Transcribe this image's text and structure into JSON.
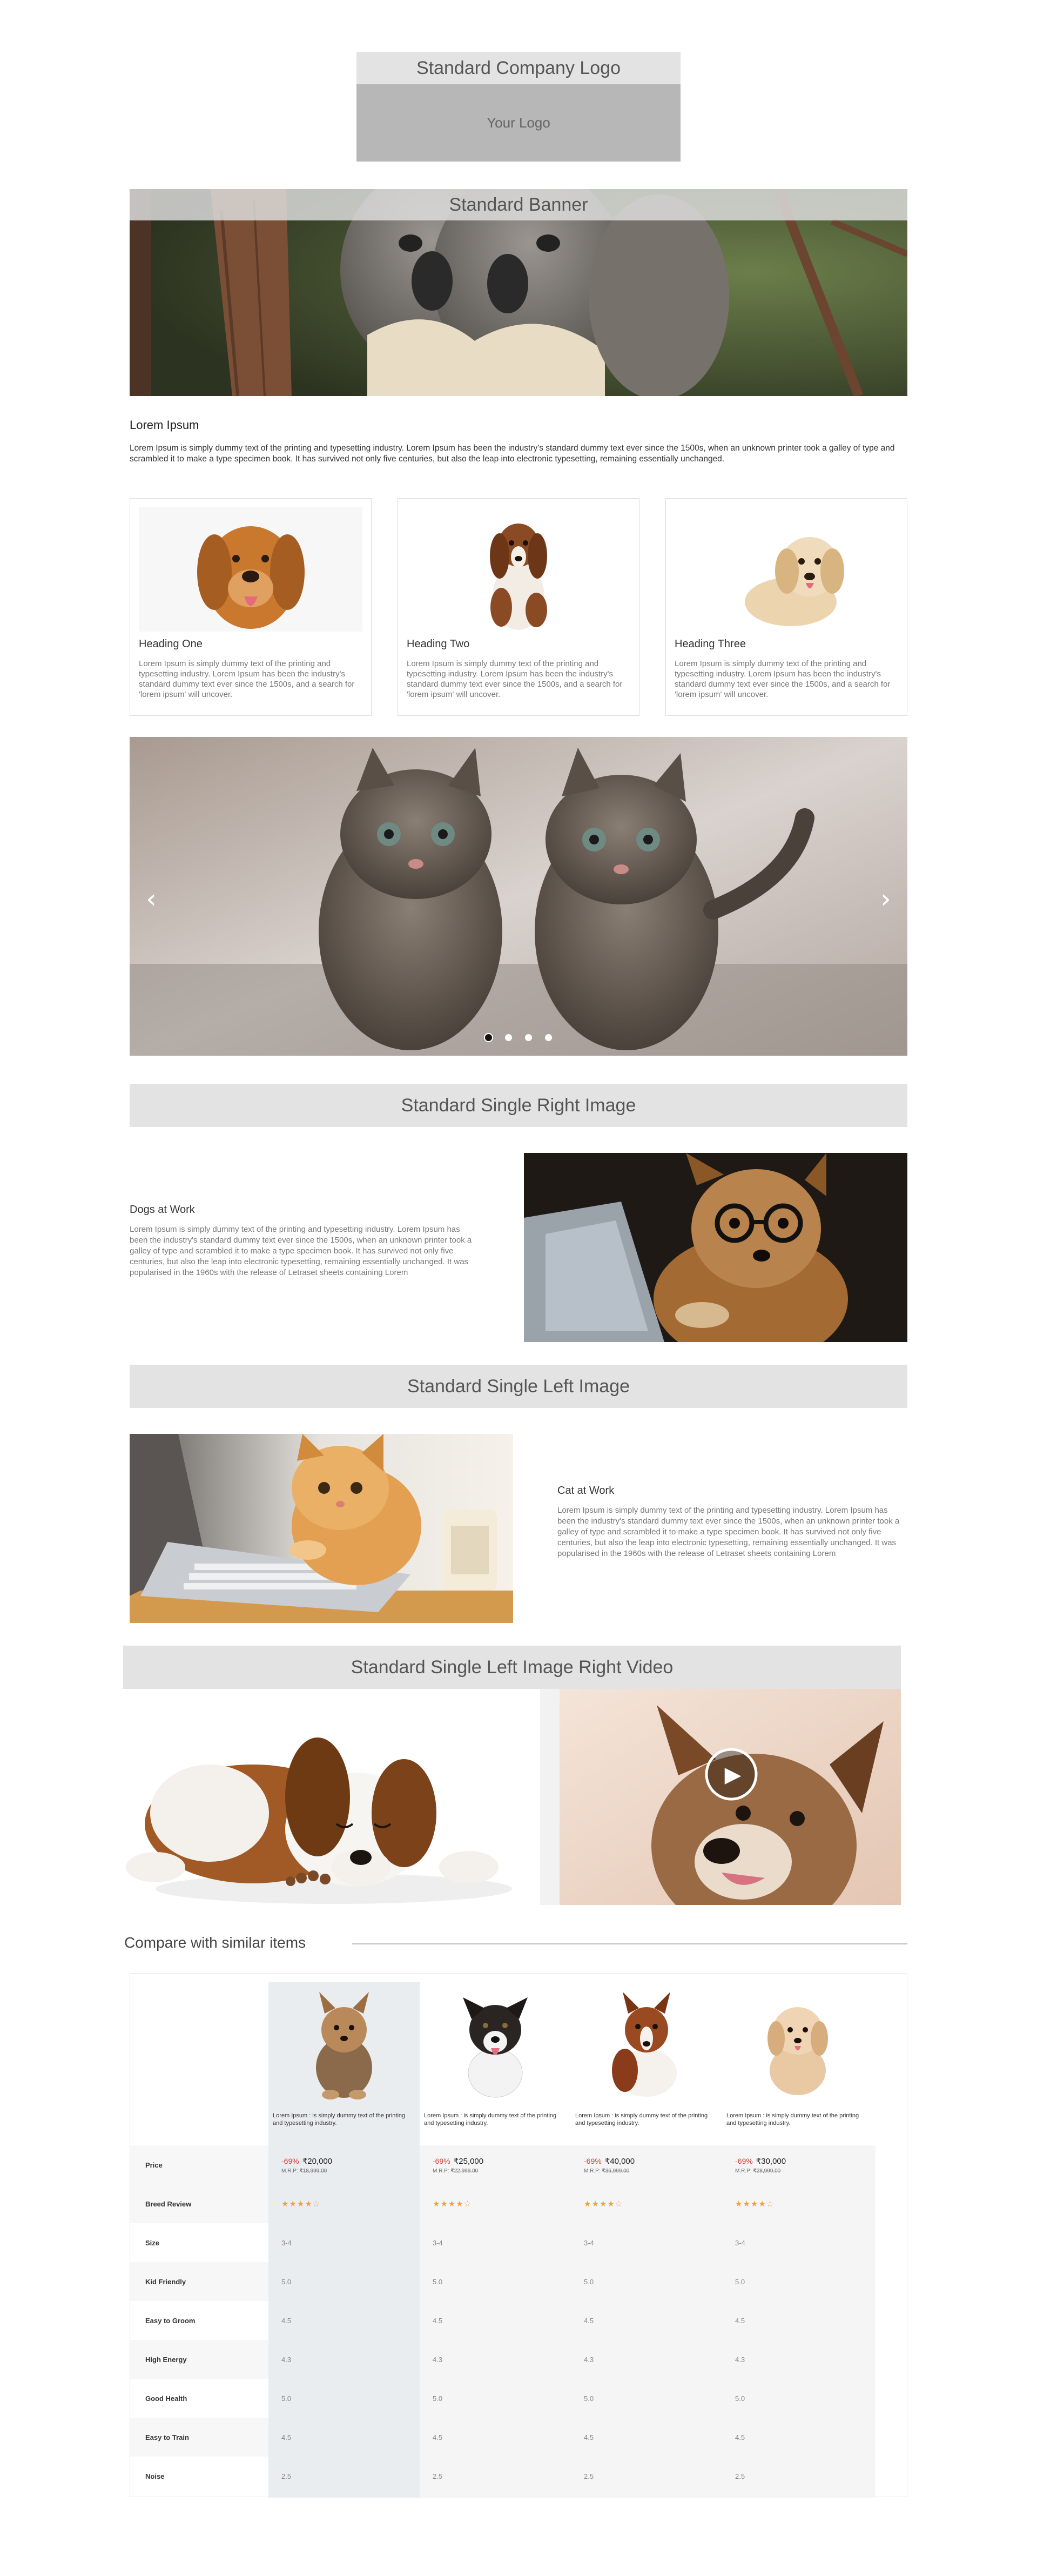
{
  "logo": {
    "title": "Standard Company Logo",
    "placeholder": "Your Logo"
  },
  "banner": {
    "title": "Standard Banner"
  },
  "intro": {
    "heading": "Lorem Ipsum",
    "text": "Lorem Ipsum is simply dummy text of the printing and typesetting industry. Lorem Ipsum has been the industry's standard dummy text ever since the 1500s, when an unknown printer took a galley of type and scrambled it to make a type specimen book. It has survived not only five centuries, but also the leap into electronic typesetting, remaining essentially unchanged."
  },
  "cards": [
    {
      "heading": "Heading One",
      "text": "Lorem Ipsum is simply dummy text of the printing and typesetting industry. Lorem Ipsum has been the industry's standard dummy text ever since the 1500s, and a search for 'lorem ipsum' will uncover."
    },
    {
      "heading": "Heading Two",
      "text": "Lorem Ipsum is simply dummy text of the printing and typesetting industry. Lorem Ipsum has been the industry's standard dummy text ever since the 1500s, and a search for 'lorem ipsum' will uncover."
    },
    {
      "heading": "Heading Three",
      "text": "Lorem Ipsum is simply dummy text of the printing and typesetting industry. Lorem Ipsum has been the industry's standard dummy text ever since the 1500s, and a search for 'lorem ipsum' will uncover."
    }
  ],
  "carousel": {
    "prev_icon": "chevron-left-icon",
    "next_icon": "chevron-right-icon",
    "prev": "‹",
    "next": "›",
    "slide_count": 4,
    "active_slide": 1
  },
  "right_image": {
    "bar": "Standard Single Right Image",
    "heading": "Dogs at Work",
    "text": "Lorem Ipsum is simply dummy text of the printing and typesetting industry. Lorem Ipsum has been the industry's standard dummy text ever since the 1500s, when an unknown printer took a galley of type and scrambled it to make a type specimen book. It has survived not only five centuries, but also the leap into electronic typesetting, remaining essentially unchanged. It was popularised in the 1960s with the release of Letraset sheets containing Lorem"
  },
  "left_image": {
    "bar": "Standard Single Left Image",
    "heading": "Cat at Work",
    "text": "Lorem Ipsum is simply dummy text of the printing and typesetting industry. Lorem Ipsum has been the industry's standard dummy text ever since the 1500s, when an unknown printer took a galley of type and scrambled it to make a type specimen book. It has survived not only five centuries, but also the leap into electronic typesetting, remaining essentially unchanged. It was popularised in the 1960s with the release of Letraset sheets containing Lorem"
  },
  "image_video": {
    "bar": "Standard Single Left Image Right Video",
    "play_icon": "play-icon"
  },
  "compare": {
    "title": "Compare with similar items",
    "products": [
      {
        "title": "Lorem Ipsum : is simply dummy text of the printing and typesetting industry.",
        "discount": "-69%",
        "price": "₹20,000",
        "mrp_label": "M.R.P:",
        "mrp": "₹18,999.00",
        "rating": "★★★★☆"
      },
      {
        "title": "Lorem Ipsum : is simply dummy text of the printing and typesetting industry.",
        "discount": "-69%",
        "price": "₹25,000",
        "mrp_label": "M.R.P:",
        "mrp": "₹22,999.00",
        "rating": "★★★★☆"
      },
      {
        "title": "Lorem Ipsum : is simply dummy text of the printing and typesetting industry.",
        "discount": "-69%",
        "price": "₹40,000",
        "mrp_label": "M.R.P:",
        "mrp": "₹36,999.00",
        "rating": "★★★★☆"
      },
      {
        "title": "Lorem Ipsum : is simply dummy text of the printing and typesetting industry.",
        "discount": "-69%",
        "price": "₹30,000",
        "mrp_label": "M.R.P:",
        "mrp": "₹28,999.00",
        "rating": "★★★★☆"
      }
    ],
    "row_labels": {
      "price": "Price",
      "review": "Breed Review",
      "size": "Size",
      "kid": "Kid Friendly",
      "groom": "Easy to Groom",
      "energy": "High Energy",
      "health": "Good Health",
      "train": "Easy to Train",
      "noise": "Noise"
    },
    "rows": {
      "size": [
        "3-4",
        "3-4",
        "3-4",
        "3-4"
      ],
      "kid": [
        "5.0",
        "5.0",
        "5.0",
        "5.0"
      ],
      "groom": [
        "4.5",
        "4.5",
        "4.5",
        "4.5"
      ],
      "energy": [
        "4.3",
        "4.3",
        "4.3",
        "4.3"
      ],
      "health": [
        "5.0",
        "5.0",
        "5.0",
        "5.0"
      ],
      "train": [
        "4.5",
        "4.5",
        "4.5",
        "4.5"
      ],
      "noise": [
        "2.5",
        "2.5",
        "2.5",
        "2.5"
      ]
    }
  },
  "colors": {
    "bar_grey": "#e3e3e3",
    "logo_box": "#b7b7b7",
    "discount_red": "#d63b3b",
    "star_orange": "#f0a52a",
    "highlight_col": "#e9edef"
  }
}
